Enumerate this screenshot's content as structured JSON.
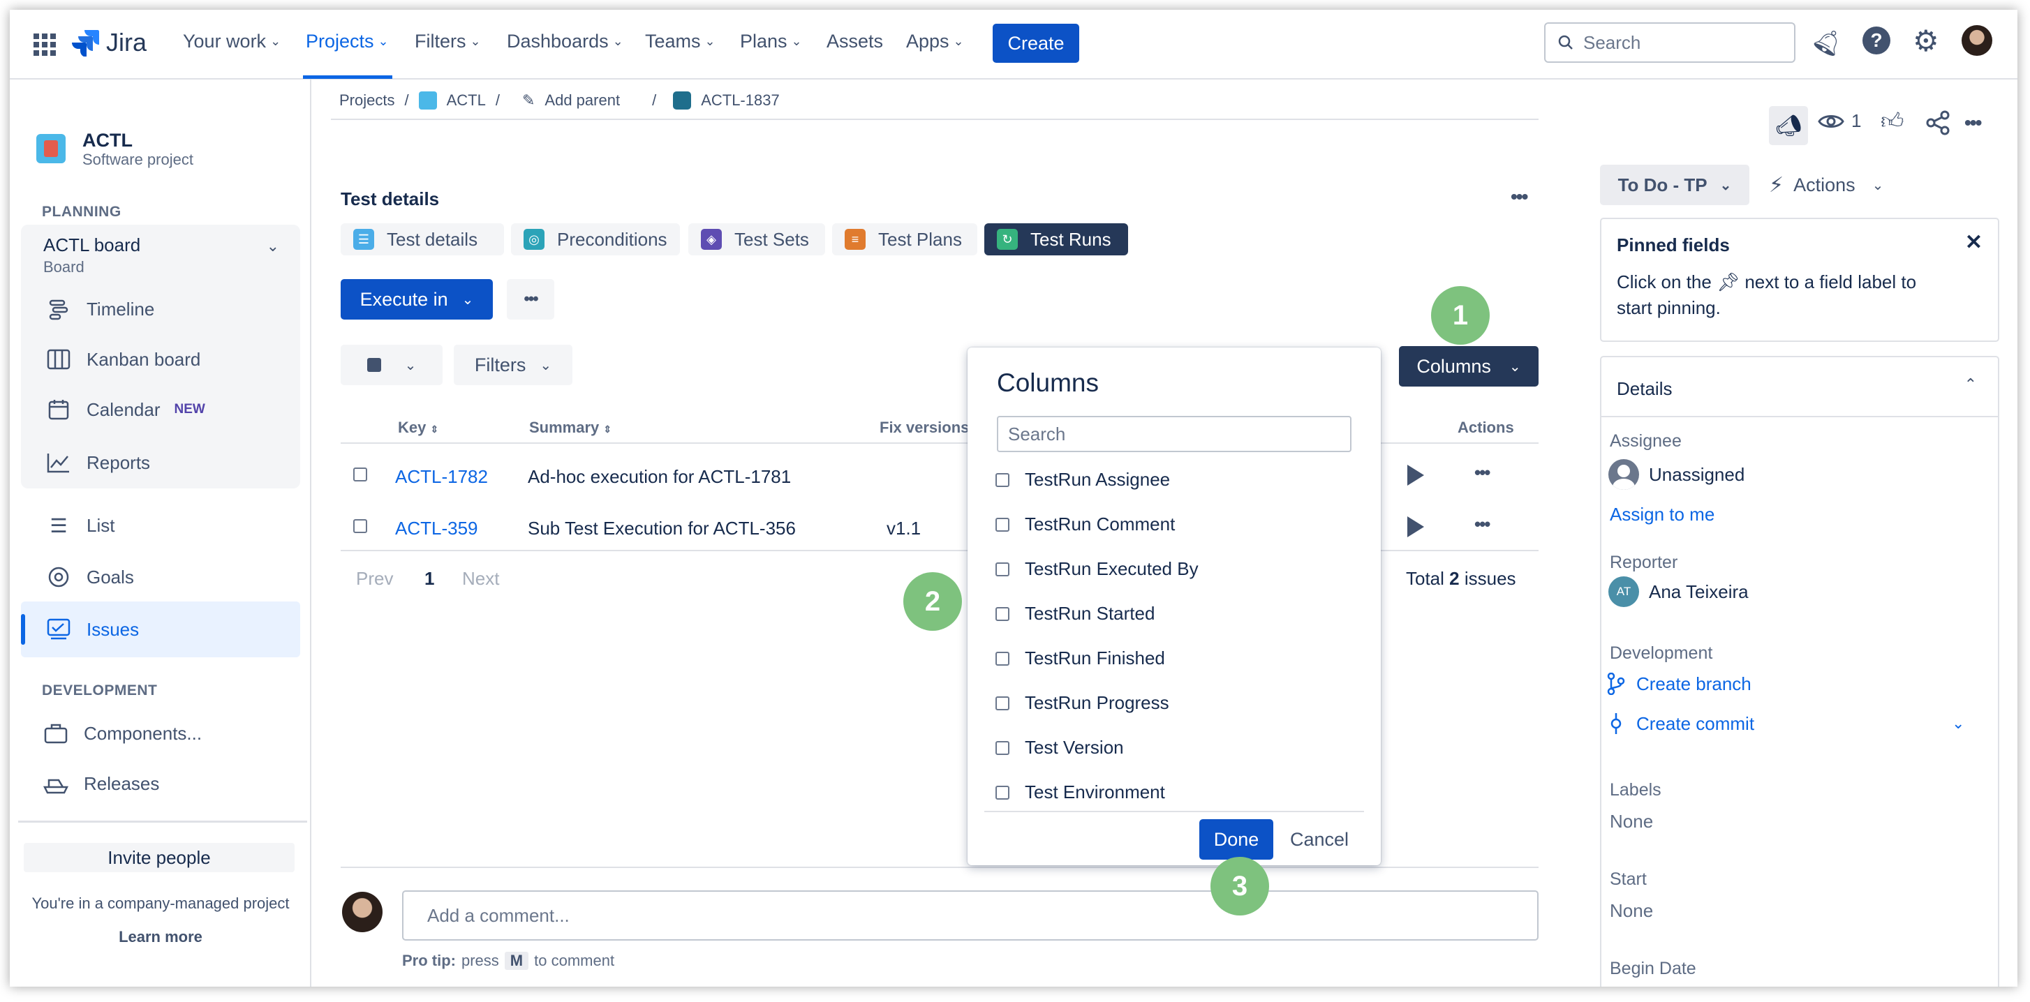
{
  "topbar": {
    "app_name": "Jira",
    "nav": [
      {
        "label": "Your work"
      },
      {
        "label": "Projects"
      },
      {
        "label": "Filters"
      },
      {
        "label": "Dashboards"
      },
      {
        "label": "Teams"
      },
      {
        "label": "Plans"
      },
      {
        "label": "Assets"
      },
      {
        "label": "Apps"
      }
    ],
    "create_label": "Create",
    "search_placeholder": "Search"
  },
  "sidebar": {
    "project_name": "ACTL",
    "project_type": "Software project",
    "planning_label": "PLANNING",
    "board_name": "ACTL board",
    "board_sub": "Board",
    "items": [
      {
        "label": "Timeline"
      },
      {
        "label": "Kanban board"
      },
      {
        "label": "Calendar",
        "badge": "NEW"
      },
      {
        "label": "Reports"
      },
      {
        "label": "List"
      },
      {
        "label": "Goals"
      },
      {
        "label": "Issues"
      }
    ],
    "development_label": "DEVELOPMENT",
    "dev_items": [
      {
        "label": "Components..."
      },
      {
        "label": "Releases"
      }
    ],
    "invite_label": "Invite people",
    "company_note": "You're in a company-managed project",
    "learn_more": "Learn more"
  },
  "breadcrumb": {
    "projects": "Projects",
    "project": "ACTL",
    "add_parent": "Add parent",
    "issue": "ACTL-1837"
  },
  "main": {
    "section_title": "Test details",
    "tabs": [
      {
        "label": "Test details"
      },
      {
        "label": "Preconditions"
      },
      {
        "label": "Test Sets"
      },
      {
        "label": "Test Plans"
      },
      {
        "label": "Test Runs"
      }
    ],
    "execute_label": "Execute in",
    "filters_label": "Filters",
    "columns_label": "Columns",
    "table": {
      "headers": [
        "Key",
        "Summary",
        "Fix versions",
        "Actions"
      ],
      "rows": [
        {
          "key": "ACTL-1782",
          "summary": "Ad-hoc execution for ACTL-1781",
          "fix": ""
        },
        {
          "key": "ACTL-359",
          "summary": "Sub Test Execution for ACTL-356",
          "fix": "v1.1"
        }
      ]
    },
    "pagination": {
      "prev": "Prev",
      "page": "1",
      "next": "Next"
    },
    "total_prefix": "Total ",
    "total_count": "2",
    "total_suffix": " issues",
    "comment_placeholder": "Add a comment...",
    "pro_tip_bold": "Pro tip:",
    "pro_tip_press": "press",
    "pro_tip_key": "M",
    "pro_tip_rest": "to comment"
  },
  "columns_popup": {
    "title": "Columns",
    "search_placeholder": "Search",
    "options": [
      {
        "label": "TestRun Assignee",
        "checked": false
      },
      {
        "label": "TestRun Comment",
        "checked": false
      },
      {
        "label": "TestRun Executed By",
        "checked": false
      },
      {
        "label": "TestRun Started",
        "checked": false
      },
      {
        "label": "TestRun Finished",
        "checked": false
      },
      {
        "label": "TestRun Progress",
        "checked": false
      },
      {
        "label": "Test Version",
        "checked": false
      },
      {
        "label": "Test Environment",
        "checked": false
      }
    ],
    "done_label": "Done",
    "cancel_label": "Cancel"
  },
  "annotations": {
    "one": "1",
    "two": "2",
    "three": "3"
  },
  "right_panel": {
    "watch_count": "1",
    "status_label": "To Do - TP",
    "actions_label": "Actions",
    "pinned_title": "Pinned fields",
    "pinned_text_1": "Click on the",
    "pinned_text_2": "next to a field label to",
    "pinned_text_3": "start pinning.",
    "details_title": "Details",
    "assignee_label": "Assignee",
    "assignee_value": "Unassigned",
    "assign_to_me": "Assign to me",
    "reporter_label": "Reporter",
    "reporter_initials": "AT",
    "reporter_value": "Ana Teixeira",
    "development_label": "Development",
    "create_branch": "Create branch",
    "create_commit": "Create commit",
    "labels_label": "Labels",
    "labels_value": "None",
    "start_label": "Start",
    "start_value": "None",
    "begin_date_label": "Begin Date"
  },
  "colors": {
    "primary": "#0c52c6",
    "dark_navy": "#253858",
    "green_badge": "#7ec27e",
    "selected_bg": "#e9f2ff"
  }
}
